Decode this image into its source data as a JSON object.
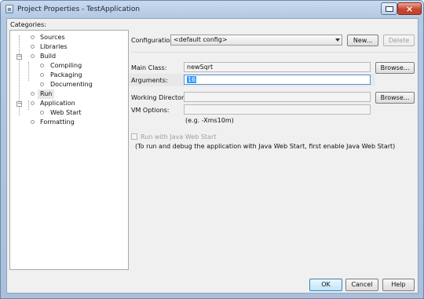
{
  "window": {
    "title": "Project Properties - TestApplication",
    "close_glyph": "×"
  },
  "categories": {
    "label": "Categories:",
    "items": [
      {
        "label": "Sources"
      },
      {
        "label": "Libraries"
      },
      {
        "label": "Build"
      },
      {
        "label": "Compiling"
      },
      {
        "label": "Packaging"
      },
      {
        "label": "Documenting"
      },
      {
        "label": "Run"
      },
      {
        "label": "Application"
      },
      {
        "label": "Web Start"
      },
      {
        "label": "Formatting"
      }
    ],
    "expander_symbol": "−"
  },
  "configuration": {
    "label": "Configuration:",
    "value": "<default config>",
    "new_label": "New...",
    "delete_label": "Delete"
  },
  "main_class": {
    "label": "Main Class:",
    "value": "newSqrt",
    "browse_label": "Browse..."
  },
  "arguments": {
    "label": "Arguments:",
    "value": "16"
  },
  "working_directory": {
    "label": "Working Directory:",
    "value": "",
    "browse_label": "Browse..."
  },
  "vm_options": {
    "label": "VM Options:",
    "value": "",
    "hint": "(e.g. -Xms10m)"
  },
  "web_start": {
    "checkbox_label": "Run with Java Web Start",
    "note": "(To run and debug the application with Java Web Start, first enable Java Web Start)"
  },
  "footer": {
    "ok_label": "OK",
    "cancel_label": "Cancel",
    "help_label": "Help"
  }
}
